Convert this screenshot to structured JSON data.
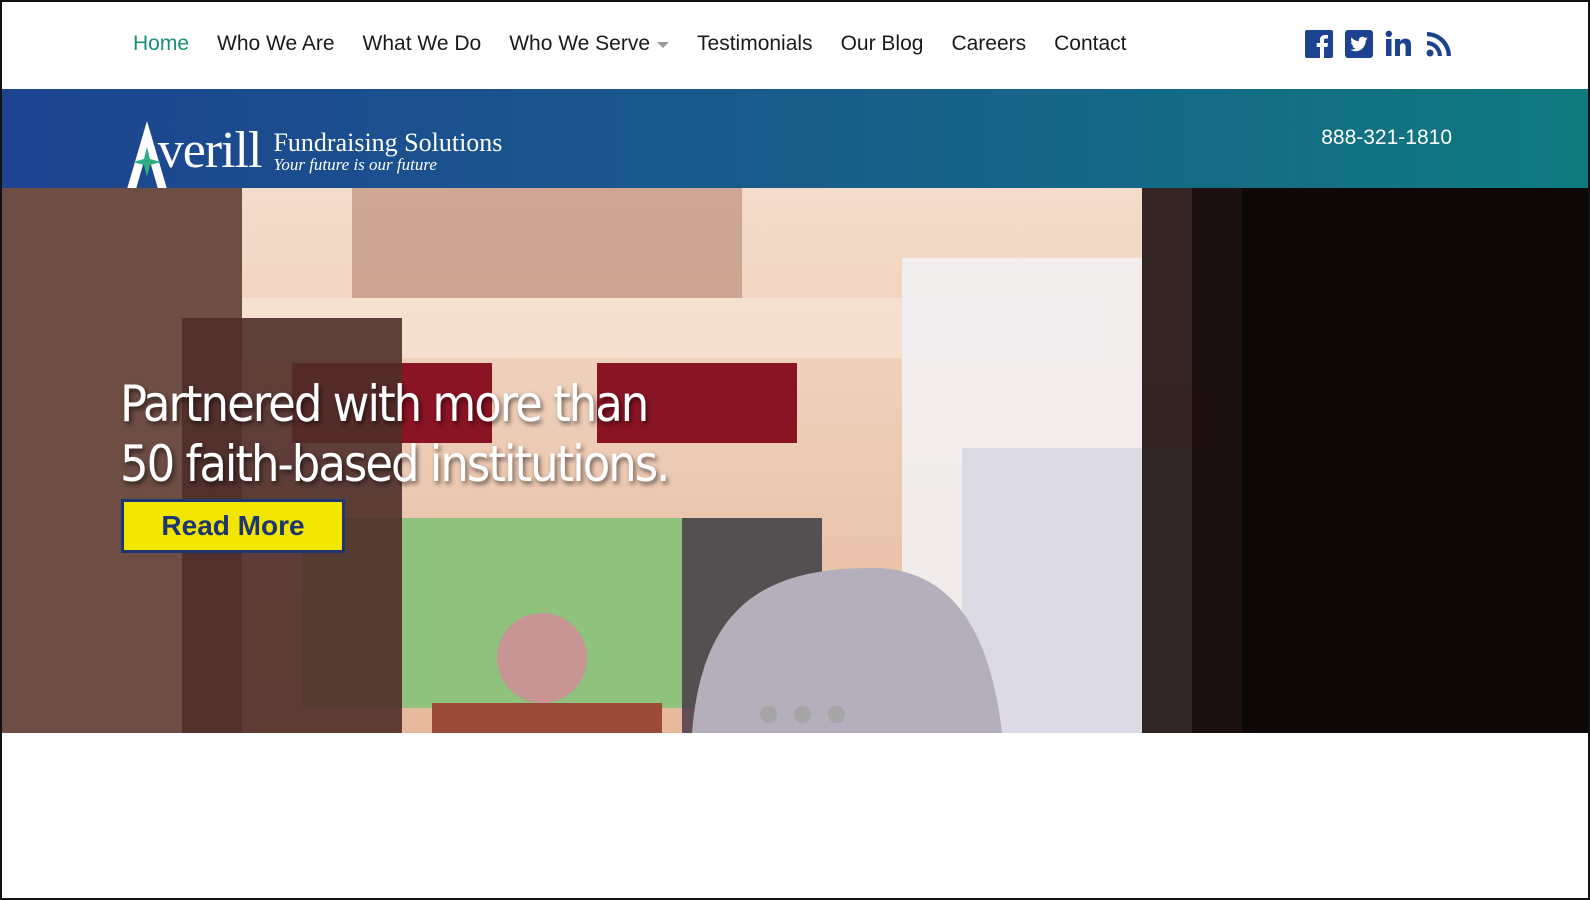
{
  "nav": {
    "items": [
      {
        "label": "Home",
        "active": true
      },
      {
        "label": "Who We Are"
      },
      {
        "label": "What We Do"
      },
      {
        "label": "Who We Serve",
        "has_dropdown": true
      },
      {
        "label": "Testimonials"
      },
      {
        "label": "Our Blog"
      },
      {
        "label": "Careers"
      },
      {
        "label": "Contact"
      }
    ],
    "social_icons": [
      "facebook-icon",
      "twitter-icon",
      "linkedin-icon",
      "rss-icon"
    ],
    "active_color": "#1a8f7a",
    "social_color": "#1d4390"
  },
  "brand": {
    "logo_word": "Averill",
    "logo_line1": "Fundraising  Solutions",
    "logo_line2": "Your future is our future",
    "phone": "888-321-1810"
  },
  "hero": {
    "headline_line1": "Partnered with more than",
    "headline_line2": "50 faith-based institutions.",
    "cta_label": "Read More",
    "cta_color": "#f2e600",
    "slides": 3,
    "active_slide": 1
  }
}
